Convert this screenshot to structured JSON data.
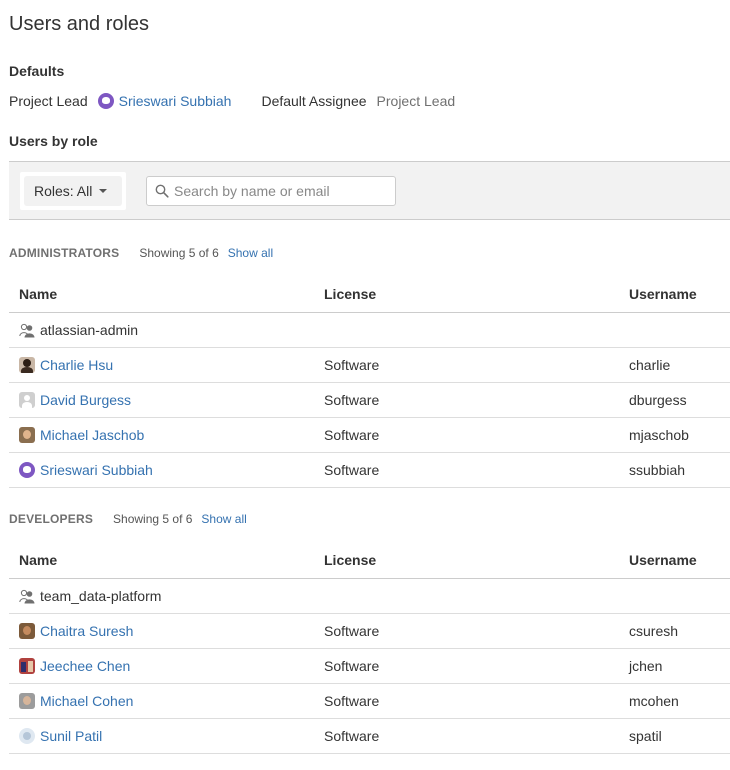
{
  "page": {
    "title": "Users and roles"
  },
  "defaults": {
    "heading": "Defaults",
    "project_lead_label": "Project Lead",
    "project_lead_value": "Srieswari Subbiah",
    "default_assignee_label": "Default Assignee",
    "default_assignee_value": "Project Lead"
  },
  "users_by_role": {
    "heading": "Users by role",
    "roles_filter_label": "Roles: All",
    "search_placeholder": "Search by name or email"
  },
  "columns": {
    "name": "Name",
    "license": "License",
    "username": "Username"
  },
  "sections": [
    {
      "role": "ADMINISTRATORS",
      "showing": "Showing 5 of 6",
      "show_all": "Show all",
      "rows": [
        {
          "type": "group",
          "name": "atlassian-admin",
          "license": "",
          "username": ""
        },
        {
          "type": "user",
          "name": "Charlie Hsu",
          "license": "Software",
          "username": "charlie",
          "avatar": "avatar-charlie"
        },
        {
          "type": "user",
          "name": "David Burgess",
          "license": "Software",
          "username": "dburgess",
          "avatar": "avatar-default"
        },
        {
          "type": "user",
          "name": "Michael Jaschob",
          "license": "Software",
          "username": "mjaschob",
          "avatar": "avatar-michael"
        },
        {
          "type": "user",
          "name": "Srieswari Subbiah",
          "license": "Software",
          "username": "ssubbiah",
          "avatar": "avatar-srieswari"
        }
      ]
    },
    {
      "role": "DEVELOPERS",
      "showing": "Showing 5 of 6",
      "show_all": "Show all",
      "rows": [
        {
          "type": "group",
          "name": "team_data-platform",
          "license": "",
          "username": ""
        },
        {
          "type": "user",
          "name": "Chaitra Suresh",
          "license": "Software",
          "username": "csuresh",
          "avatar": "avatar-chaitra"
        },
        {
          "type": "user",
          "name": "Jeechee Chen",
          "license": "Software",
          "username": "jchen",
          "avatar": "avatar-jeechee"
        },
        {
          "type": "user",
          "name": "Michael Cohen",
          "license": "Software",
          "username": "mcohen",
          "avatar": "avatar-mcohen"
        },
        {
          "type": "user",
          "name": "Sunil Patil",
          "license": "Software",
          "username": "spatil",
          "avatar": "avatar-sunil"
        }
      ]
    }
  ],
  "colors": {
    "link": "#3572b0",
    "text": "#333333",
    "muted": "#707070",
    "toolbar_bg": "#f2f2f2"
  }
}
